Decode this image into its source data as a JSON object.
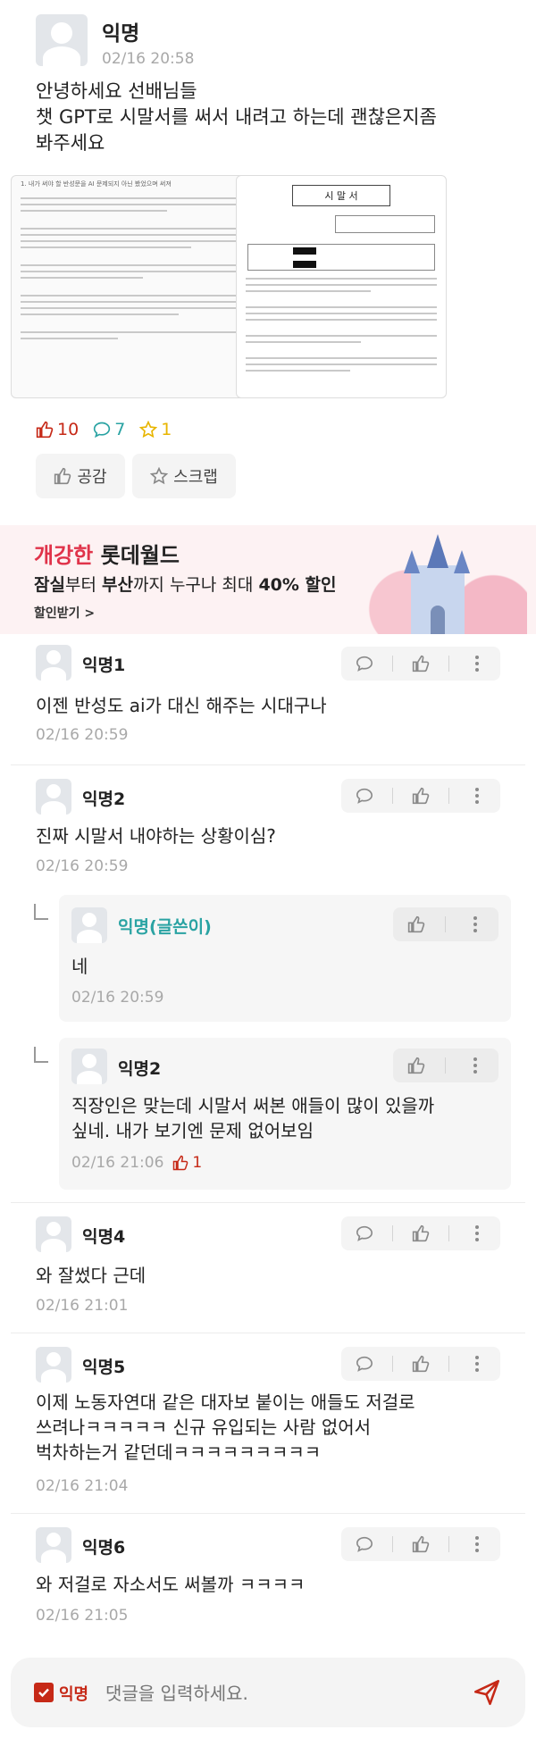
{
  "post": {
    "author": "익명",
    "date": "02/16 20:58",
    "body_lines": [
      "안녕하세요 선배님들",
      "챗 GPT로 시말서를 써서 내려고 하는데 괜찮은지좀",
      "봐주세요"
    ],
    "doc_left_title": "1. 내가 써야 할 반성문을 AI 문제되지 아닌 봤었으며 써져",
    "doc_right_title": "시 말 서",
    "likes": "10",
    "comments": "7",
    "scraps": "1",
    "like_button": "공감",
    "scrap_button": "스크랩"
  },
  "ad": {
    "brand_part1": "개강한",
    "brand_part2": "롯데월드",
    "line_a": "잠실",
    "line_b": "부터",
    "line_c": "부산",
    "line_d": "까지 누구나 최대",
    "line_e": "40% 할인",
    "cta": "할인받기 >"
  },
  "comments": [
    {
      "author": "익명1",
      "text": [
        "이젠 반성도 ai가 대신 해주는 시대구나"
      ],
      "date": "02/16 20:59"
    },
    {
      "author": "익명2",
      "text": [
        "진짜 시말서 내야하는 상황이심?"
      ],
      "date": "02/16 20:59"
    },
    {
      "author": "익명(글쓴이)",
      "text": [
        "네"
      ],
      "date": "02/16 20:59"
    },
    {
      "author": "익명2",
      "text": [
        "직장인은 맞는데 시말서 써본 애들이 많이 있을까",
        "싶네. 내가 보기엔 문제 없어보임"
      ],
      "date": "02/16 21:06",
      "likes": "1"
    },
    {
      "author": "익명4",
      "text": [
        "와 잘썼다 근데"
      ],
      "date": "02/16 21:01"
    },
    {
      "author": "익명5",
      "text": [
        "이제 노동자연대 같은 대자보 붙이는 애들도 저걸로",
        "쓰려나ㅋㅋㅋㅋㅋ 신규 유입되는 사람 없어서",
        "벅차하는거 같던데ㅋㅋㅋㅋㅋㅋㅋㅋㅋ"
      ],
      "date": "02/16 21:04"
    },
    {
      "author": "익명6",
      "text": [
        "와 저걸로 자소서도 써볼까 ㅋㅋㅋㅋ"
      ],
      "date": "02/16 21:05"
    }
  ],
  "input": {
    "anon_label": "익명",
    "placeholder": "댓글을 입력하세요."
  },
  "colors": {
    "accent_red": "#c62917",
    "teal": "#2aa3a3",
    "icon_gray": "#8a8a8a"
  }
}
